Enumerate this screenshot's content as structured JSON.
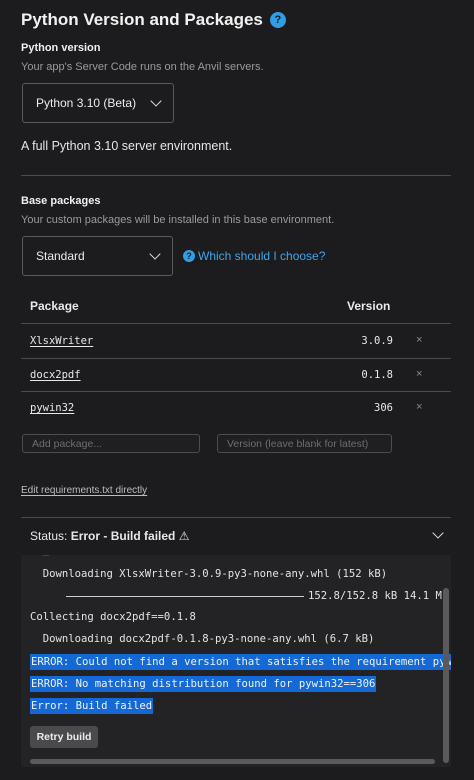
{
  "header": {
    "title": "Python Version and Packages",
    "help_icon": "?"
  },
  "python_version": {
    "label": "Python version",
    "description": "Your app's Server Code runs on the Anvil servers.",
    "selected": "Python 3.10 (Beta)",
    "summary": "A full Python 3.10 server environment."
  },
  "base_packages": {
    "label": "Base packages",
    "description": "Your custom packages will be installed in this base environment.",
    "selected": "Standard",
    "help_link": "Which should I choose?"
  },
  "table": {
    "headers": {
      "package": "Package",
      "version": "Version"
    },
    "rows": [
      {
        "package": "XlsxWriter",
        "version": "3.0.9",
        "remove": "×"
      },
      {
        "package": "docx2pdf",
        "version": "0.1.8",
        "remove": "×"
      },
      {
        "package": "pywin32",
        "version": "306",
        "remove": "×"
      }
    ],
    "add_package_placeholder": "Add package...",
    "version_placeholder": "Version (leave blank for latest)"
  },
  "edit_link": "Edit requirements.txt directly",
  "status": {
    "prefix": "Status:",
    "value": "Error - Build failed",
    "warning_icon": "⚠"
  },
  "log": {
    "line1": "  Downloading XlsxWriter-3.0.9-py3-none-any.whl (152 kB)",
    "progress": "152.8/152.8 kB 14.1 M",
    "line3": "Collecting docx2pdf==0.1.8",
    "line4": "  Downloading docx2pdf-0.1.8-py3-none-any.whl (6.7 kB)",
    "error1": "ERROR: Could not find a version that satisfies the requirement pyw",
    "error2": "ERROR: No matching distribution found for pywin32==306",
    "error3": "Error: Build failed"
  },
  "retry_button": "Retry build",
  "colors": {
    "accent": "#3ca6ee",
    "error_highlight": "#1469d6",
    "background": "#1c1c1e"
  }
}
